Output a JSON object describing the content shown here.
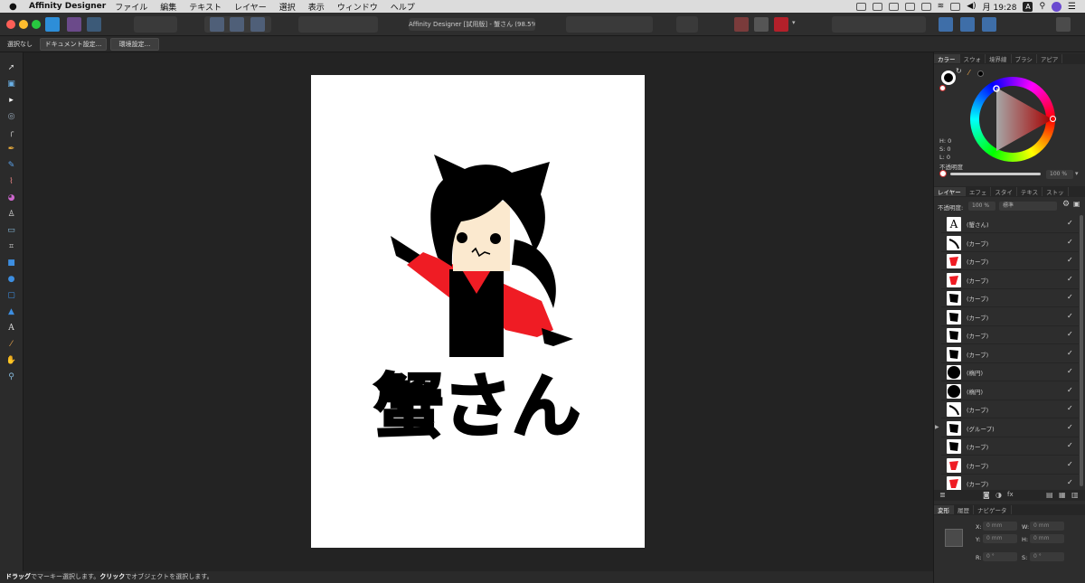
{
  "menubar": {
    "apple": "",
    "app_name": "Affinity Designer",
    "items": [
      "ファイル",
      "編集",
      "テキスト",
      "レイヤー",
      "選択",
      "表示",
      "ウィンドウ",
      "ヘルプ"
    ],
    "clock": "月 19:28",
    "input_badge": "A"
  },
  "toolbar": {
    "doc_title": "Affinity Designer [試用版] - 蟹さん (98.5%)"
  },
  "context_bar": {
    "selection_status": "選択なし",
    "document_setup_button": "ドキュメント設定...",
    "preferences_button": "環境設定..."
  },
  "canvas": {
    "artwork_text": "蟹さん",
    "colors": {
      "black": "#000000",
      "red": "#ef1c24",
      "skin": "#fbe9cf",
      "page": "#ffffff"
    }
  },
  "color_panel": {
    "tabs": [
      "カラー",
      "スウォ",
      "境界線",
      "ブラシ",
      "アピア"
    ],
    "h_label": "H: 0",
    "s_label": "S: 0",
    "l_label": "L: 0",
    "opacity_label": "不透明度",
    "opacity_value": "100 %"
  },
  "layers_panel": {
    "tabs": [
      "レイヤー",
      "エフェ",
      "スタイ",
      "テキス",
      "ストッ"
    ],
    "opacity_label": "不透明度:",
    "opacity_value": "100 %",
    "blend_mode": "標準",
    "rows": [
      {
        "name": "(蟹さん)",
        "thumb": "text",
        "checked": "✓"
      },
      {
        "name": "(カーブ)",
        "thumb": "black-stroke",
        "checked": "✓"
      },
      {
        "name": "(カーブ)",
        "thumb": "red-shape",
        "checked": "✓"
      },
      {
        "name": "(カーブ)",
        "thumb": "red-shape",
        "checked": "✓"
      },
      {
        "name": "(カーブ)",
        "thumb": "black-shape",
        "checked": "✓"
      },
      {
        "name": "(カーブ)",
        "thumb": "black-shape",
        "checked": "✓"
      },
      {
        "name": "(カーブ)",
        "thumb": "black-shape",
        "checked": "✓"
      },
      {
        "name": "(カーブ)",
        "thumb": "black-shape",
        "checked": "✓"
      },
      {
        "name": "(楕円)",
        "thumb": "black-ellipse",
        "checked": "✓"
      },
      {
        "name": "(楕円)",
        "thumb": "black-ellipse",
        "checked": "✓"
      },
      {
        "name": "(カーブ)",
        "thumb": "black-stroke",
        "checked": "✓"
      },
      {
        "name": "(グループ)",
        "thumb": "black-shape",
        "checked": "✓"
      },
      {
        "name": "(カーブ)",
        "thumb": "black-shape",
        "checked": "✓"
      },
      {
        "name": "(カーブ)",
        "thumb": "red-shape",
        "checked": "✓"
      },
      {
        "name": "(カーブ)",
        "thumb": "red-shape",
        "checked": "✓"
      }
    ]
  },
  "transform_panel": {
    "tabs": [
      "変形",
      "履歴",
      "ナビゲータ"
    ],
    "x_label": "X:",
    "y_label": "Y:",
    "w_label": "W:",
    "h_label": "H:",
    "r_label": "R:",
    "s_label": "S:",
    "x_value": "0 mm",
    "y_value": "0 mm",
    "w_value": "0 mm",
    "h_value": "0 mm",
    "r_value": "0 °",
    "s_value": "0 °"
  },
  "status_bar": {
    "drag_bold": "ドラッグ",
    "drag_text": "でマーキー選択します。",
    "click_bold": "クリック",
    "click_text": "でオブジェクトを選択します。"
  }
}
